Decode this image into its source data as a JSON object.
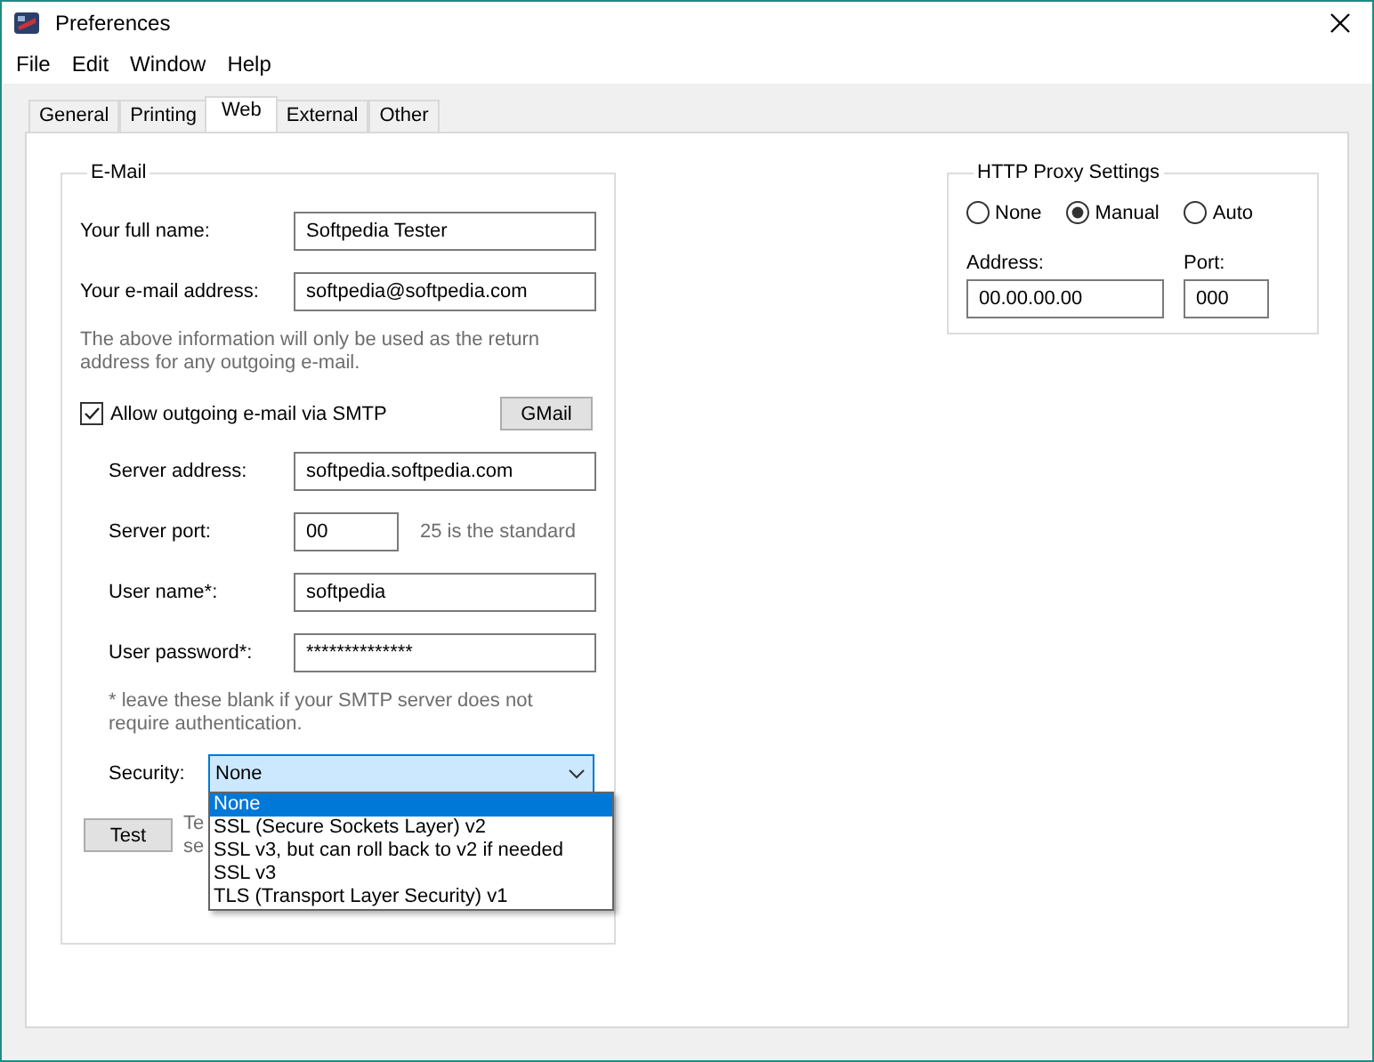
{
  "window": {
    "title": "Preferences"
  },
  "menu": [
    "File",
    "Edit",
    "Window",
    "Help"
  ],
  "tabs": [
    {
      "label": "General",
      "selected": false
    },
    {
      "label": "Printing",
      "selected": false
    },
    {
      "label": "Web",
      "selected": true
    },
    {
      "label": "External",
      "selected": false
    },
    {
      "label": "Other",
      "selected": false
    }
  ],
  "email": {
    "title": "E-Mail",
    "identity": [
      {
        "label": "Your full name:",
        "value": "Softpedia Tester"
      },
      {
        "label": "Your e-mail address:",
        "value": "softpedia@softpedia.com"
      }
    ],
    "note": "The above information will only be used as the return address for any outgoing e-mail.",
    "smtp": {
      "label": "Allow outgoing e-mail via SMTP",
      "checked": true
    },
    "gmail_button": "GMail",
    "fields": [
      {
        "kind": "text",
        "label": "Server address:",
        "value": "softpedia.softpedia.com"
      },
      {
        "kind": "port",
        "label": "Server port:",
        "value": "00",
        "hint": "25 is the standard"
      },
      {
        "kind": "text",
        "label": "User name*:",
        "value": "softpedia"
      },
      {
        "kind": "text",
        "label": "User password*:",
        "value": "**************"
      }
    ],
    "auth_note": "* leave these blank if your SMTP server does not require authentication.",
    "security": {
      "label": "Security:",
      "value": "None",
      "options": [
        {
          "label": "None",
          "selected": true
        },
        {
          "label": "SSL (Secure Sockets Layer) v2",
          "selected": false
        },
        {
          "label": "SSL v3, but can roll back to v2 if needed",
          "selected": false
        },
        {
          "label": "SSL v3",
          "selected": false
        },
        {
          "label": "TLS (Transport Layer Security) v1",
          "selected": false
        }
      ]
    },
    "test_button": "Test",
    "test_note_lines": [
      "Te",
      "se"
    ]
  },
  "proxy": {
    "title": "HTTP Proxy Settings",
    "modes": [
      {
        "label": "None",
        "selected": false
      },
      {
        "label": "Manual",
        "selected": true
      },
      {
        "label": "Auto",
        "selected": false
      }
    ],
    "address_label": "Address:",
    "address_value": "00.00.00.00",
    "port_label": "Port:",
    "port_value": "000"
  }
}
